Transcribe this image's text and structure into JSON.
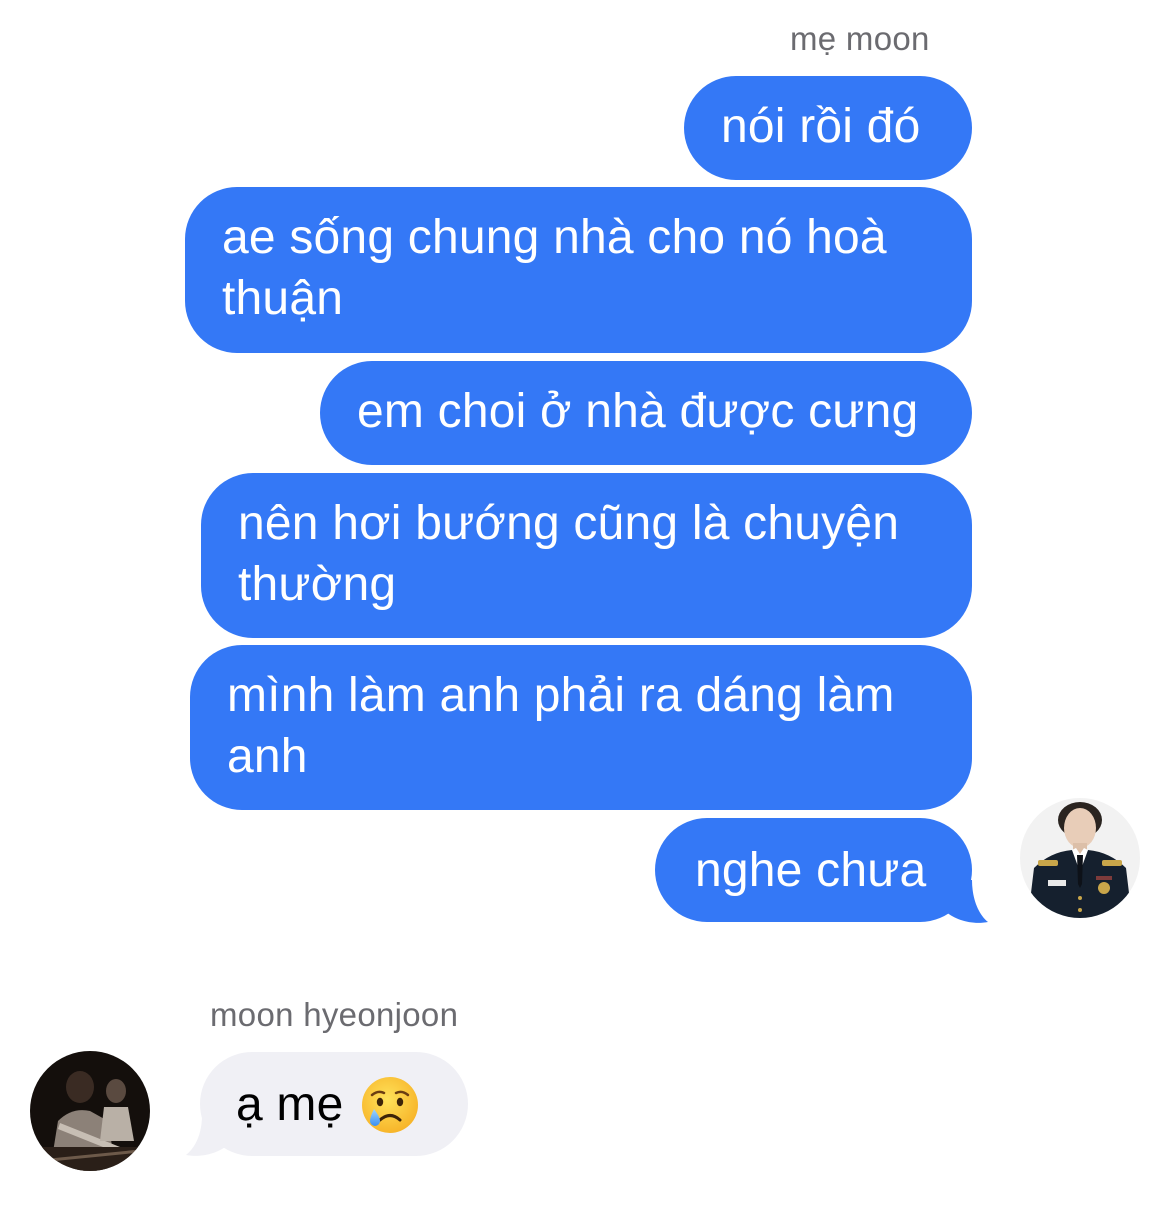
{
  "outgoing_sender": "mẹ moon",
  "incoming_sender": "moon hyeonjoon",
  "outgoing_messages": [
    "nói rồi đó",
    "ae sống chung nhà cho nó hoà thuận",
    "em choi ở nhà được cưng",
    "nên hơi bướng cũng là chuyện thường",
    "mình làm anh phải ra dáng làm anh",
    "nghe chưa"
  ],
  "incoming_messages": [
    "ạ mẹ"
  ],
  "emoji": "crying-face",
  "colors": {
    "outgoing_bubble": "#3478f6",
    "incoming_bubble": "#f0f0f5",
    "sender_name": "#6b6b70"
  }
}
